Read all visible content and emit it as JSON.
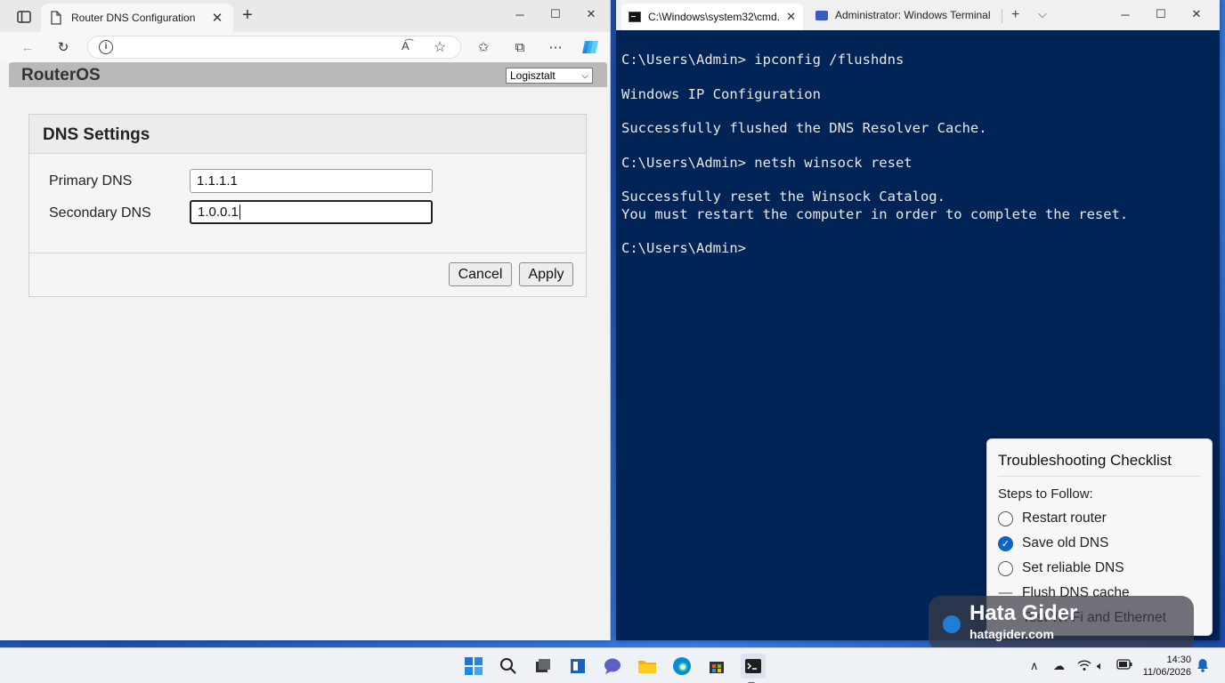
{
  "browser": {
    "tab_title": "Router DNS Configuration",
    "router": {
      "brand": "RouterOS",
      "select_value": "Logisztalt",
      "panel_title": "DNS Settings",
      "primary_label": "Primary DNS",
      "primary_value": "1.1.1.1",
      "secondary_label": "Secondary DNS",
      "secondary_value": "1.0.0.1",
      "cancel_label": "Cancel",
      "apply_label": "Apply"
    }
  },
  "terminal": {
    "tab1_title": "C:\\Windows\\system32\\cmd.e:",
    "tab2_title": "Administrator: Windows Terminal",
    "lines": [
      "C:\\Users\\Admin> ipconfig /flushdns",
      "",
      "Windows IP Configuration",
      "",
      "Successfully flushed the DNS Resolver Cache.",
      "",
      "C:\\Users\\Admin> netsh winsock reset",
      "",
      "Successfully reset the Winsock Catalog.",
      "You must restart the computer in order to complete the reset.",
      "",
      "C:\\Users\\Admin>"
    ]
  },
  "checklist": {
    "title": "Troubleshooting Checklist",
    "steps_label": "Steps to Follow:",
    "items": [
      {
        "label": "Restart router",
        "state": "unchecked"
      },
      {
        "label": "Save old DNS",
        "state": "checked"
      },
      {
        "label": "Set reliable DNS",
        "state": "unchecked"
      },
      {
        "label": "Flush DNS cache",
        "state": "dash"
      },
      {
        "label": "Test Wi-Fi and Ethernet",
        "state": "dash"
      }
    ]
  },
  "watermark": {
    "title": "Hata Gider",
    "subtitle": "hatagider.com"
  },
  "taskbar": {
    "time": "14:30",
    "date": "11/06/2026"
  },
  "colors": {
    "terminal_bg": "#012456",
    "checkbox_accent": "#0b66c2",
    "router_header": "#b9b9b9"
  }
}
